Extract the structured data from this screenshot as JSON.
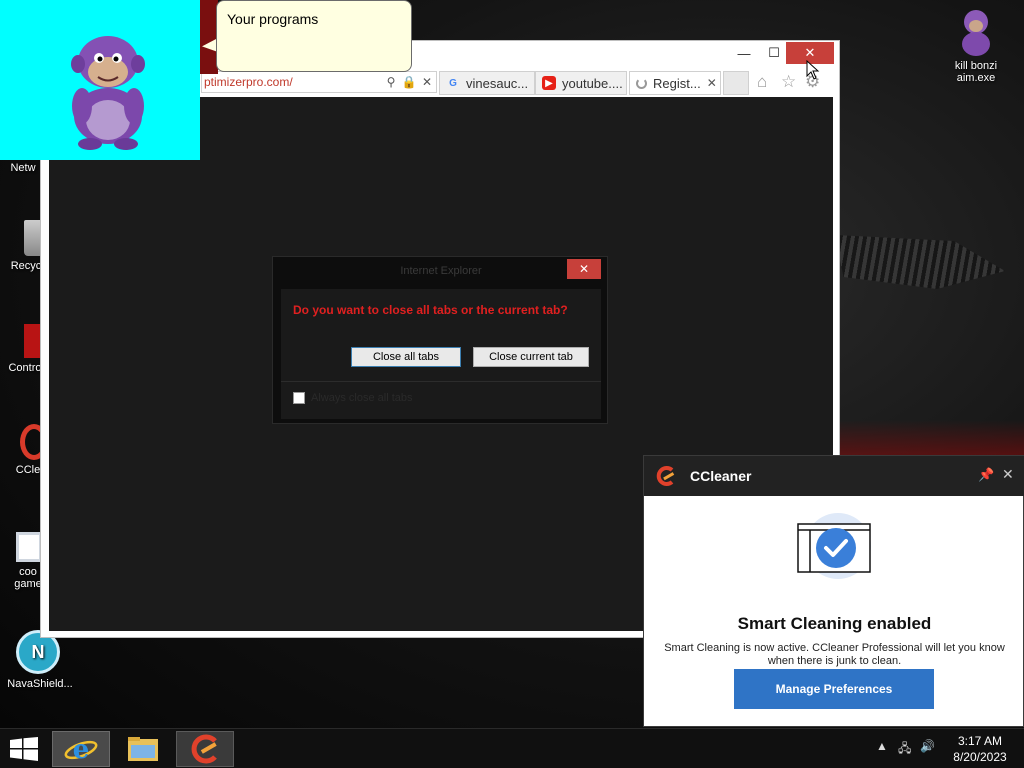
{
  "desktop": {
    "icons": [
      {
        "label": "Netw"
      },
      {
        "label": "Recyc"
      },
      {
        "label": "Contro"
      },
      {
        "label": "CCle"
      },
      {
        "label": "coo"
      },
      {
        "label": "game"
      },
      {
        "label": "NavaShield..."
      }
    ],
    "kill_icon_label_line1": "kill bonzi",
    "kill_icon_label_line2": "aim.exe"
  },
  "bonzi": {
    "speech": "Your programs"
  },
  "browser": {
    "address": "ptimizerpro.com/",
    "tabs": [
      {
        "label": "vinesauc...",
        "icon": "google-icon"
      },
      {
        "label": "youtube....",
        "icon": "youtube-icon"
      },
      {
        "label": "Regist...",
        "icon": "loading-icon"
      }
    ],
    "minimize_glyph": "—",
    "maximize_glyph": "☐",
    "close_glyph": "✕"
  },
  "dialog": {
    "title": "Internet Explorer",
    "question": "Do you want to close all tabs or the current tab?",
    "close_all_label": "Close all tabs",
    "close_current_label": "Close current tab",
    "always_label": "Always close all tabs",
    "close_glyph": "✕"
  },
  "ccleaner": {
    "title": "CCleaner",
    "heading": "Smart Cleaning enabled",
    "desc_line1": "Smart Cleaning is now active. CCleaner Professional will let you know",
    "desc_line2": "when there is junk to clean.",
    "button": "Manage Preferences",
    "close_glyph": "✕",
    "accent": "#2f74c6"
  },
  "taskbar": {
    "time": "3:17 AM",
    "date": "8/20/2023"
  }
}
